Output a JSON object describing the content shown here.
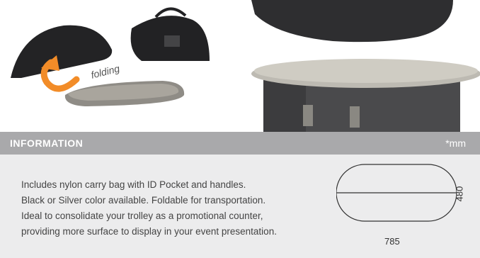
{
  "header": {
    "title": "INFORMATION",
    "unit": "*mm"
  },
  "photos": {
    "folding_label": "folding"
  },
  "description": {
    "lines": [
      "Includes nylon carry bag with ID Pocket and handles.",
      "Black or Silver color available. Foldable for transportation.",
      "Ideal to consolidate your trolley as a promotional counter,",
      "providing more surface to display in your event presentation."
    ]
  },
  "dimensions": {
    "width": "785",
    "height": "480"
  },
  "colors": {
    "header_bg": "#a9a9ab",
    "panel_bg": "#ececed",
    "arrow": "#f28c28"
  }
}
